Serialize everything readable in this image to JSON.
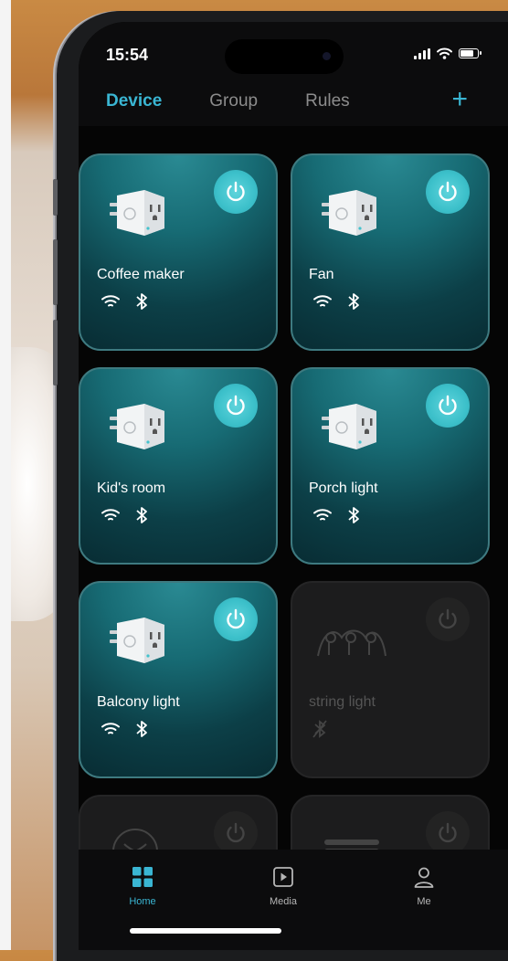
{
  "status": {
    "time": "15:54"
  },
  "tabs": [
    {
      "label": "Device",
      "active": true
    },
    {
      "label": "Group",
      "active": false
    },
    {
      "label": "Rules",
      "active": false
    }
  ],
  "add_icon": "plus-icon",
  "devices": [
    {
      "name": "Coffee maker",
      "type": "smart-plug",
      "on": true,
      "wifi": true,
      "bluetooth": true
    },
    {
      "name": "Fan",
      "type": "smart-plug",
      "on": true,
      "wifi": true,
      "bluetooth": true
    },
    {
      "name": "Kid's room",
      "type": "smart-plug",
      "on": true,
      "wifi": true,
      "bluetooth": true
    },
    {
      "name": "Porch light",
      "type": "smart-plug",
      "on": true,
      "wifi": true,
      "bluetooth": true
    },
    {
      "name": "Balcony light",
      "type": "smart-plug",
      "on": true,
      "wifi": true,
      "bluetooth": true
    },
    {
      "name": "string light",
      "type": "string-light",
      "on": false,
      "wifi": false,
      "bluetooth": false
    },
    {
      "name": "",
      "type": "fan-device",
      "on": false
    },
    {
      "name": "",
      "type": "light-strip",
      "on": false
    }
  ],
  "nav": [
    {
      "label": "Home",
      "icon": "grid-icon",
      "active": true
    },
    {
      "label": "Media",
      "icon": "media-play-icon",
      "active": false
    },
    {
      "label": "Me",
      "icon": "person-icon",
      "active": false
    }
  ],
  "colors": {
    "accent": "#3ab6d3",
    "card_on": "#176b74",
    "card_off": "#1c1c1d",
    "power_on": "#3cc0ca"
  }
}
